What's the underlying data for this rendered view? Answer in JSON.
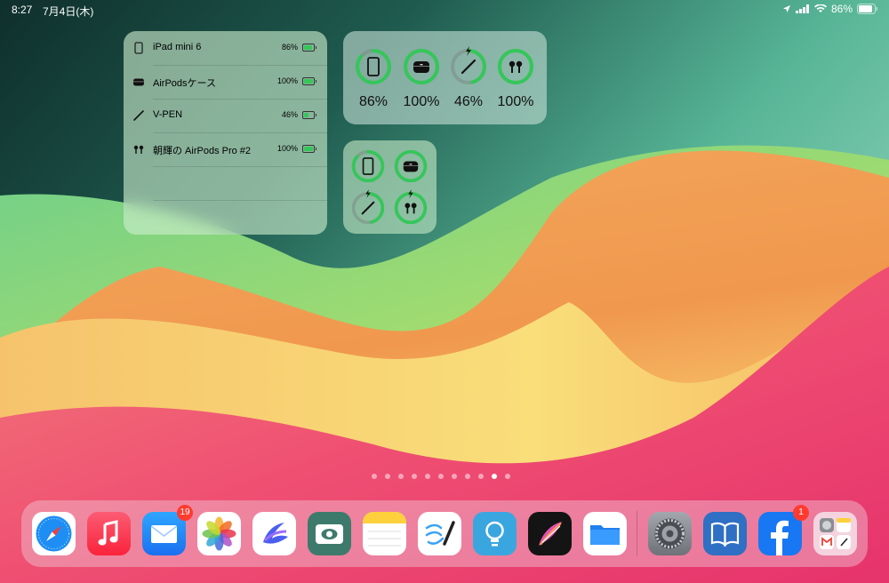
{
  "status_bar": {
    "time": "8:27",
    "date": "7月4日(木)",
    "battery_pct": "86%"
  },
  "list_widget": {
    "rows": [
      {
        "name": "iPad mini 6",
        "pct": "86%",
        "icon": "ipad-icon",
        "level": 0.86,
        "charging": false
      },
      {
        "name": "AirPodsケース",
        "pct": "100%",
        "icon": "airpods-case-icon",
        "level": 1.0,
        "charging": false
      },
      {
        "name": "V-PEN",
        "pct": "46%",
        "icon": "pencil-icon",
        "level": 0.46,
        "charging": true
      },
      {
        "name": "朝輝の AirPods Pro #2",
        "pct": "100%",
        "icon": "airpods-pro-icon",
        "level": 1.0,
        "charging": true
      }
    ]
  },
  "rings_widget": {
    "items": [
      {
        "label": "86%",
        "level": 0.86,
        "icon": "ipad-icon",
        "charging": false
      },
      {
        "label": "100%",
        "level": 1.0,
        "icon": "airpods-case-icon",
        "charging": false
      },
      {
        "label": "46%",
        "level": 0.46,
        "icon": "pencil-icon",
        "charging": true
      },
      {
        "label": "100%",
        "level": 1.0,
        "icon": "airpods-pro-icon",
        "charging": false
      }
    ]
  },
  "grid_widget": {
    "items": [
      {
        "level": 0.86,
        "icon": "ipad-icon",
        "charging": false
      },
      {
        "level": 1.0,
        "icon": "airpods-case-icon",
        "charging": false
      },
      {
        "level": 0.46,
        "icon": "pencil-icon",
        "charging": true
      },
      {
        "level": 1.0,
        "icon": "airpods-pro-icon",
        "charging": true
      }
    ]
  },
  "page_dots": {
    "count": 11,
    "active_index": 9
  },
  "dock": {
    "apps": [
      {
        "name": "safari-icon"
      },
      {
        "name": "music-icon"
      },
      {
        "name": "mail-icon",
        "badge": "19"
      },
      {
        "name": "photos-icon"
      },
      {
        "name": "lumafusion-icon"
      },
      {
        "name": "scanner-icon"
      },
      {
        "name": "notes-icon"
      },
      {
        "name": "freeform-icon"
      },
      {
        "name": "tips-icon"
      },
      {
        "name": "procreate-icon"
      },
      {
        "name": "files-icon"
      },
      {
        "name": "settings-icon"
      },
      {
        "name": "books-icon"
      },
      {
        "name": "facebook-icon",
        "badge": "1"
      },
      {
        "name": "app-library-icon"
      }
    ]
  },
  "colors": {
    "ring_green": "#34c759",
    "badge_red": "#ff3b30"
  }
}
